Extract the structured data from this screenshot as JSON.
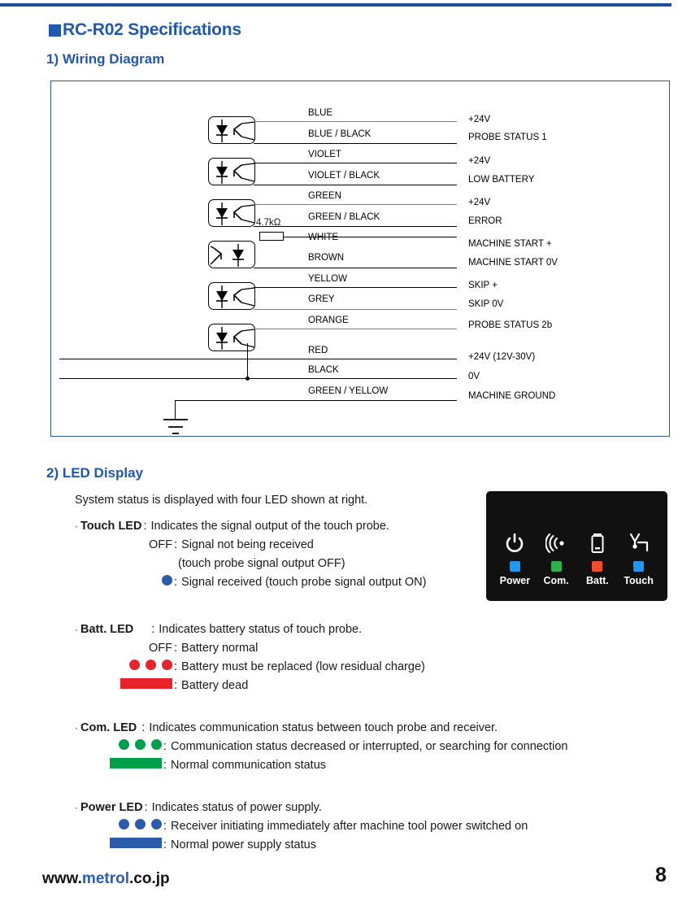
{
  "header": {
    "section_title": "RC-R02 Specifications",
    "sub1": "1) Wiring Diagram",
    "sub2": "2) LED Display"
  },
  "wiring": {
    "resistor_label": "4.7kΩ",
    "rows": [
      {
        "wire": "BLUE",
        "signal": "+24V"
      },
      {
        "wire": "BLUE / BLACK",
        "signal": "PROBE STATUS 1"
      },
      {
        "wire": "VIOLET",
        "signal": "+24V"
      },
      {
        "wire": "VIOLET / BLACK",
        "signal": "LOW BATTERY"
      },
      {
        "wire": "GREEN",
        "signal": "+24V"
      },
      {
        "wire": "GREEN / BLACK",
        "signal": "ERROR"
      },
      {
        "wire": "WHITE",
        "signal": "MACHINE START +"
      },
      {
        "wire": "BROWN",
        "signal": "MACHINE START 0V"
      },
      {
        "wire": "YELLOW",
        "signal": "SKIP +"
      },
      {
        "wire": "GREY",
        "signal": "SKIP 0V"
      },
      {
        "wire": "ORANGE",
        "signal": "PROBE STATUS 2b"
      },
      {
        "wire": "RED",
        "signal": "+24V (12V-30V)"
      },
      {
        "wire": "BLACK",
        "signal": "0V"
      },
      {
        "wire": "GREEN / YELLOW",
        "signal": "MACHINE GROUND"
      }
    ]
  },
  "led_display": {
    "intro": "System status is displayed with four LED shown at right.",
    "groups": [
      {
        "name": "Touch LED",
        "name_colon": ":",
        "description": "Indicates the signal output of the touch probe.",
        "states": [
          {
            "glyph": "off",
            "glyph_text": "OFF",
            "text": "Signal not being received"
          },
          {
            "glyph": "none",
            "glyph_text": "",
            "text": "(touch probe signal output OFF)"
          },
          {
            "glyph": "dot",
            "glyph_text": "",
            "text": "Signal received (touch probe signal output ON)"
          }
        ]
      },
      {
        "name": "Batt. LED",
        "name_colon": ":",
        "description": "Indicates battery status of touch probe.",
        "states": [
          {
            "glyph": "off",
            "glyph_text": "OFF",
            "text": "Battery normal"
          },
          {
            "glyph": "dots3",
            "glyph_text": "",
            "text": "Battery must be replaced (low residual charge)"
          },
          {
            "glyph": "bar",
            "glyph_text": "",
            "text": "Battery dead"
          }
        ]
      },
      {
        "name": "Com. LED",
        "name_colon": ":",
        "description": "Indicates communication status between touch probe and receiver.",
        "states": [
          {
            "glyph": "dots3",
            "glyph_text": "",
            "text": "Communication status decreased or interrupted, or searching for connection"
          },
          {
            "glyph": "bar",
            "glyph_text": "",
            "text": "Normal communication status"
          }
        ]
      },
      {
        "name": "Power LED",
        "name_colon": ":",
        "description": "Indicates status of power supply.",
        "states": [
          {
            "glyph": "dots3",
            "glyph_text": "",
            "text": "Receiver initiating immediately after machine tool power switched on"
          },
          {
            "glyph": "bar",
            "glyph_text": "",
            "text": "Normal power supply status"
          }
        ]
      }
    ]
  },
  "receiver_panel": {
    "indicators": [
      {
        "label": "Power",
        "icon": "power-symbol-icon",
        "led_color": "#2196f3"
      },
      {
        "label": "Com.",
        "icon": "wireless-waves-icon",
        "led_color": "#2db34a"
      },
      {
        "label": "Batt.",
        "icon": "battery-icon",
        "led_color": "#f04f23"
      },
      {
        "label": "Touch",
        "icon": "touch-probe-icon",
        "led_color": "#2196f3"
      }
    ]
  },
  "footer": {
    "url_prefix": "www.",
    "url_brand": "metrol",
    "url_suffix": ".co.jp",
    "page_number": "8"
  },
  "colors": {
    "heading_blue": "#1f58b0",
    "rule_blue": "#1f4e9c",
    "led_red": "#e8232a",
    "led_green": "#00a04a",
    "led_blue": "#2b5cab"
  }
}
